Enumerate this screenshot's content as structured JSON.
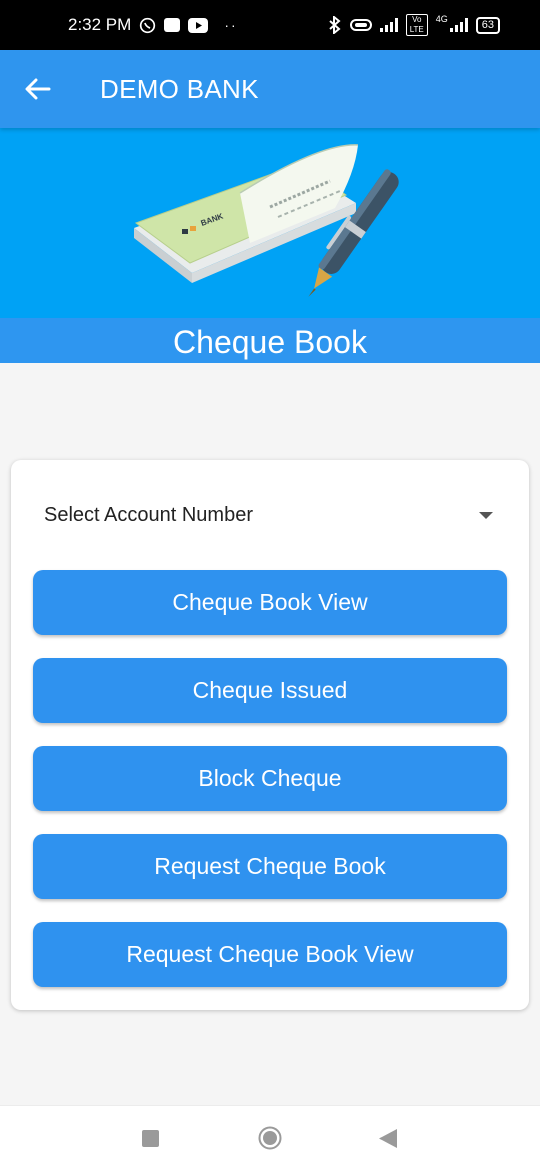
{
  "status_bar": {
    "time": "2:32 PM",
    "notification_icons": [
      "whatsapp-icon",
      "photo-icon",
      "youtube-icon"
    ],
    "dots": "··",
    "network_label": "4G",
    "volte_label": "Vo LTE",
    "battery_level": "63"
  },
  "app_bar": {
    "title": "DEMO BANK",
    "back_icon": "arrow-left-icon"
  },
  "banner": {
    "image_icon": "cheque-book-with-pen-illustration",
    "cheque_text": "BANK",
    "title": "Cheque Book"
  },
  "form": {
    "account_select_label": "Select Account Number"
  },
  "actions": [
    {
      "label": "Cheque Book View"
    },
    {
      "label": "Cheque Issued"
    },
    {
      "label": "Block Cheque"
    },
    {
      "label": "Request Cheque Book"
    },
    {
      "label": "Request Cheque Book View"
    }
  ],
  "nav_bar": {
    "buttons": [
      "recents-square-icon",
      "home-circle-icon",
      "back-triangle-icon"
    ]
  },
  "colors": {
    "primary": "#2f95ee",
    "banner_bg": "#00a2f5",
    "button": "#2f92ef",
    "background": "#f5f5f5"
  }
}
